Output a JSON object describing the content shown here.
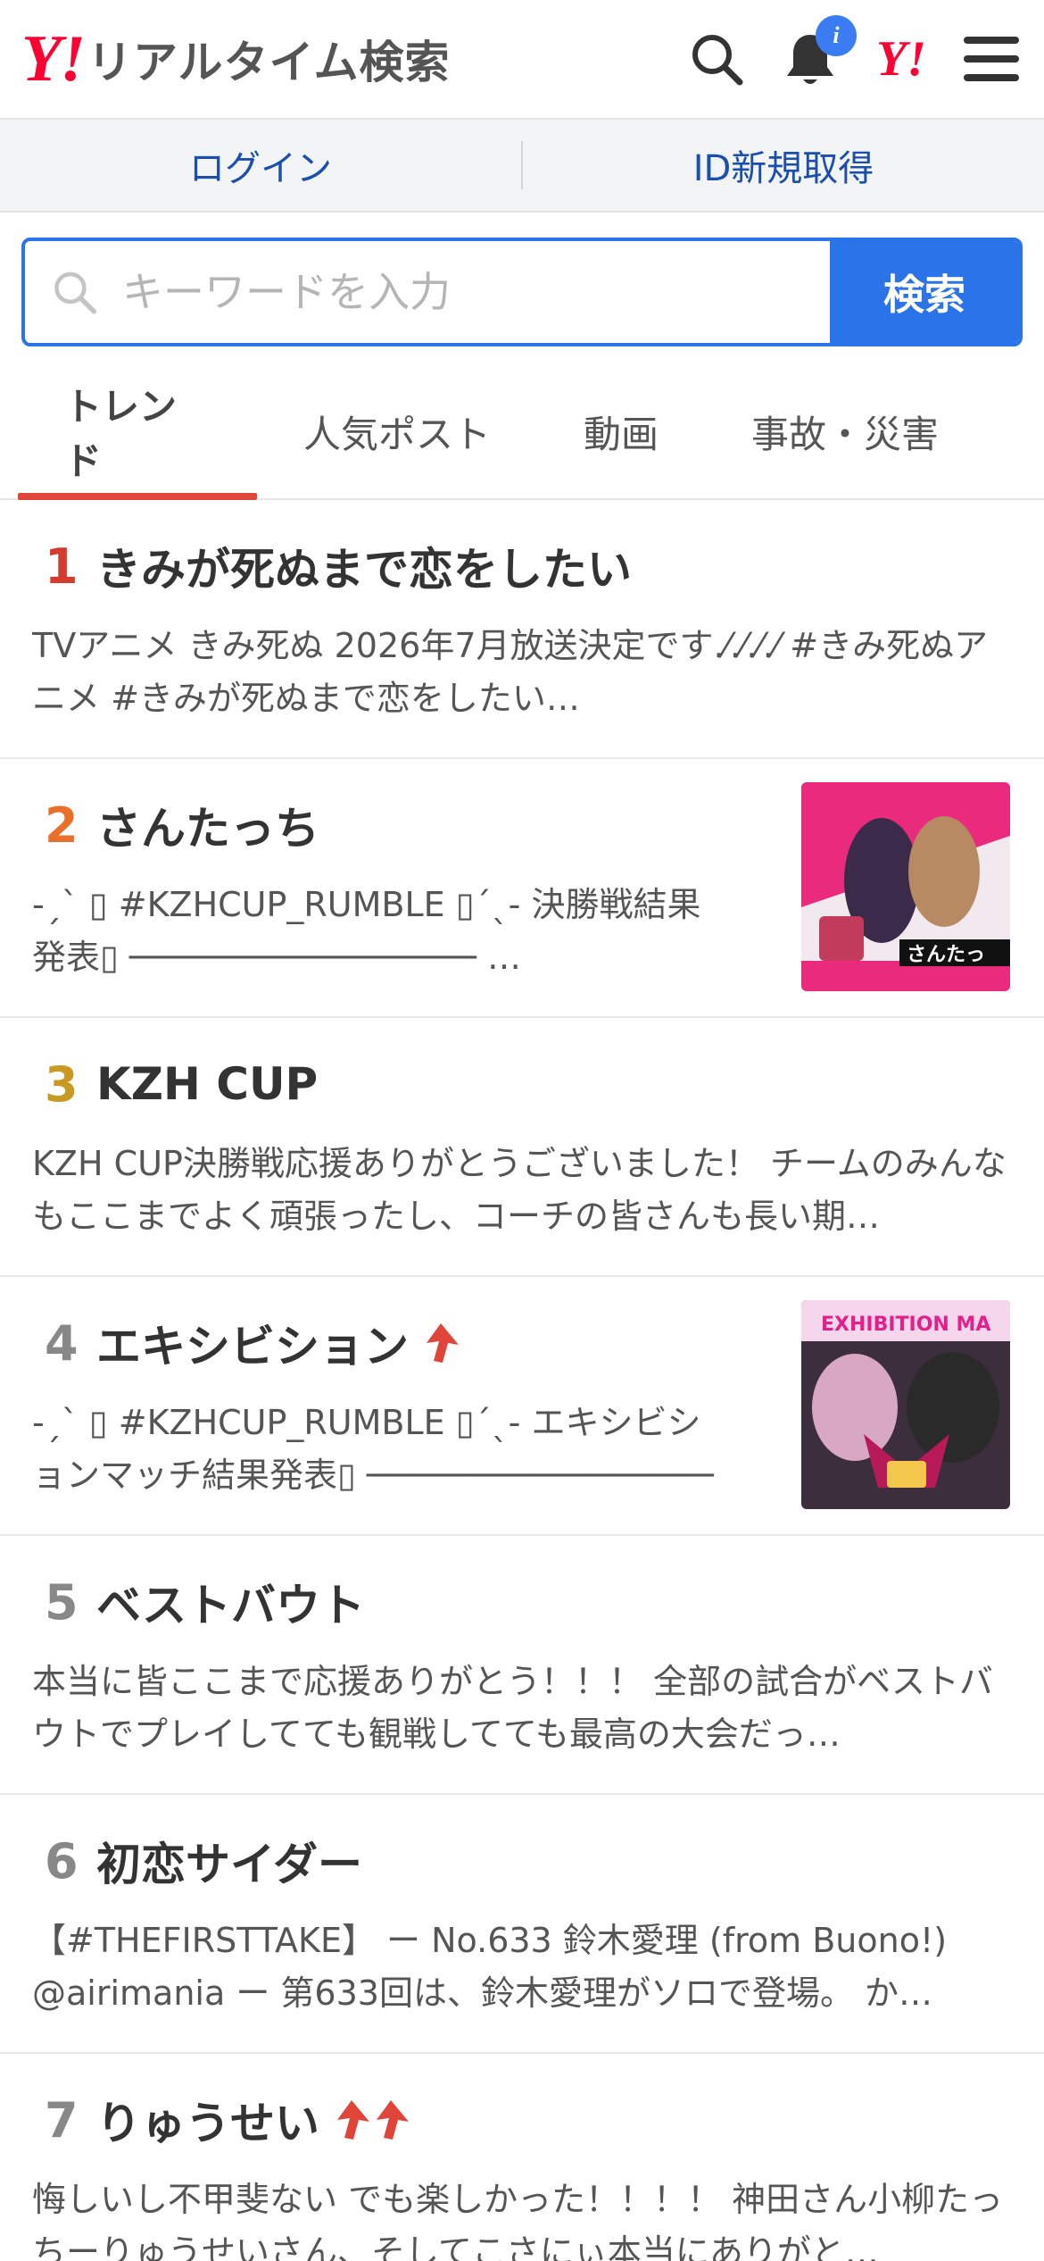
{
  "header": {
    "logo_mark": "Y!",
    "title": "リアルタイム検索",
    "bell_badge": "i",
    "yahoo_mark": "Y!",
    "icons": [
      "search-icon",
      "bell-icon",
      "yahoo-logo-icon",
      "menu-icon"
    ]
  },
  "login": {
    "login_label": "ログイン",
    "register_label": "ID新規取得"
  },
  "search": {
    "placeholder": "キーワードを入力",
    "value": "",
    "button_label": "検索"
  },
  "tabs": [
    {
      "label": "トレンド",
      "active": true
    },
    {
      "label": "人気ポスト",
      "active": false
    },
    {
      "label": "動画",
      "active": false
    },
    {
      "label": "事故・災害",
      "active": false
    }
  ],
  "trends": [
    {
      "rank": "1",
      "rank_color": "#d63b2f",
      "word": "きみが死ぬまで恋をしたい",
      "arrows": 0,
      "desc": "TVアニメ きみ死ぬ 2026年7月放送決定です.⁄.⁄.⁄.⁄ #きみ死ぬアニメ #きみが死ぬまで恋をしたい…",
      "thumb": false
    },
    {
      "rank": "2",
      "rank_color": "#e8702a",
      "word": "さんたっち",
      "arrows": 0,
      "desc": "-ˏˋ ▯ #KZHCUP_RUMBLE ▯ˊˎ- 決勝戦結果発表▯ ───────────────── …",
      "thumb": true,
      "thumb_text": "さんたっ"
    },
    {
      "rank": "3",
      "rank_color": "#c99a21",
      "word": "KZH CUP",
      "arrows": 0,
      "desc": "KZH CUP決勝戦応援ありがとうございました！ チームのみんなもここまでよく頑張ったし、コーチの皆さんも長い期…",
      "thumb": false
    },
    {
      "rank": "4",
      "rank_color": "#888888",
      "word": "エキシビション",
      "arrows": 1,
      "desc": "-ˏˋ ▯ #KZHCUP_RUMBLE ▯ˊˎ- エキシビションマッチ結果発表▯ ───────────────── …",
      "thumb": true,
      "thumb_text": "EXHIBITION MA"
    },
    {
      "rank": "5",
      "rank_color": "#888888",
      "word": "ベストバウト",
      "arrows": 0,
      "desc": "本当に皆ここまで応援ありがとう！！！ 全部の試合がベストバウトでプレイしてても観戦してても最高の大会だっ…",
      "thumb": false
    },
    {
      "rank": "6",
      "rank_color": "#888888",
      "word": "初恋サイダー",
      "arrows": 0,
      "desc": "【#THEFIRSTTAKE】 ー No.633 鈴木愛理 (from Buono!) @airimania ー 第633回は、鈴木愛理がソロで登場。 か…",
      "thumb": false
    },
    {
      "rank": "7",
      "rank_color": "#888888",
      "word": "りゅうせい",
      "arrows": 2,
      "desc": "悔しいし不甲斐ない でも楽しかった！！！！ 神田さん小柳たっちーりゅうせいさん、そしてこさにぃ本当にありがと…",
      "thumb": false
    }
  ]
}
